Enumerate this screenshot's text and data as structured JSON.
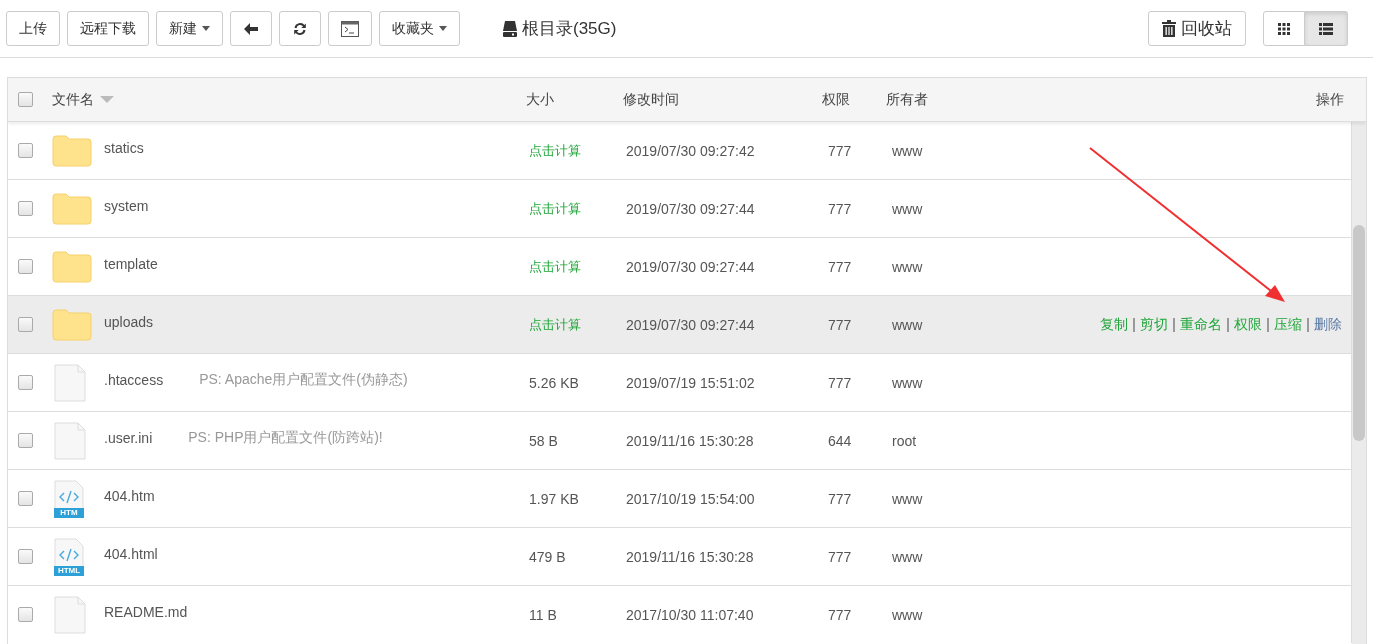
{
  "toolbar": {
    "buttons": [
      {
        "label": "上传",
        "kind": "text"
      },
      {
        "label": "远程下载",
        "kind": "text"
      },
      {
        "label": "新建",
        "kind": "dropdown"
      },
      {
        "kind": "back"
      },
      {
        "kind": "refresh"
      },
      {
        "kind": "terminal"
      },
      {
        "label": "收藏夹",
        "kind": "dropdown"
      }
    ],
    "path": "根目录(35G)",
    "recycle": "回收站",
    "views": [
      {
        "kind": "grid",
        "selected": false
      },
      {
        "kind": "list",
        "selected": true
      }
    ]
  },
  "table": {
    "select_all": {
      "checked": false
    },
    "columns": [
      "文件名",
      "大小",
      "修改时间",
      "权限",
      "所有者",
      "操作"
    ],
    "rows": [
      {
        "kind": "folder",
        "name": "statics",
        "size": "点击计算",
        "modified": "2019/07/30 09:27:42",
        "permission": "777",
        "owner": "www",
        "checked": false,
        "hovered": false
      },
      {
        "kind": "folder",
        "name": "system",
        "size": "点击计算",
        "modified": "2019/07/30 09:27:44",
        "permission": "777",
        "owner": "www",
        "checked": false,
        "hovered": false
      },
      {
        "kind": "folder",
        "name": "template",
        "size": "点击计算",
        "modified": "2019/07/30 09:27:44",
        "permission": "777",
        "owner": "www",
        "checked": false,
        "hovered": false
      },
      {
        "kind": "folder",
        "name": "uploads",
        "size": "点击计算",
        "modified": "2019/07/30 09:27:44",
        "permission": "777",
        "owner": "www",
        "checked": false,
        "hovered": true,
        "actions": [
          {
            "label": "复制",
            "kind": "normal"
          },
          {
            "label": "剪切",
            "kind": "normal"
          },
          {
            "label": "重命名",
            "kind": "normal"
          },
          {
            "label": "权限",
            "kind": "normal"
          },
          {
            "label": "压缩",
            "kind": "normal"
          },
          {
            "label": "删除",
            "kind": "delete"
          }
        ]
      },
      {
        "kind": "file",
        "name": ".htaccess",
        "note": "PS: Apache用户配置文件(伪静态)",
        "size": "5.26 KB",
        "modified": "2019/07/19 15:51:02",
        "permission": "777",
        "owner": "www",
        "checked": false,
        "hovered": false
      },
      {
        "kind": "file",
        "name": ".user.ini",
        "note": "PS: PHP用户配置文件(防跨站)!",
        "size": "58 B",
        "modified": "2019/11/16 15:30:28",
        "permission": "644",
        "owner": "root",
        "checked": false,
        "hovered": false
      },
      {
        "kind": "html",
        "icon_label": "HTM",
        "name": "404.htm",
        "size": "1.97 KB",
        "modified": "2017/10/19 15:54:00",
        "permission": "777",
        "owner": "www",
        "checked": false,
        "hovered": false
      },
      {
        "kind": "html",
        "icon_label": "HTML",
        "name": "404.html",
        "size": "479 B",
        "modified": "2019/11/16 15:30:28",
        "permission": "777",
        "owner": "www",
        "checked": false,
        "hovered": false
      },
      {
        "kind": "file",
        "name": "README.md",
        "size": "11 B",
        "modified": "2017/10/30 11:07:40",
        "permission": "777",
        "owner": "www",
        "checked": false,
        "hovered": false
      }
    ]
  }
}
